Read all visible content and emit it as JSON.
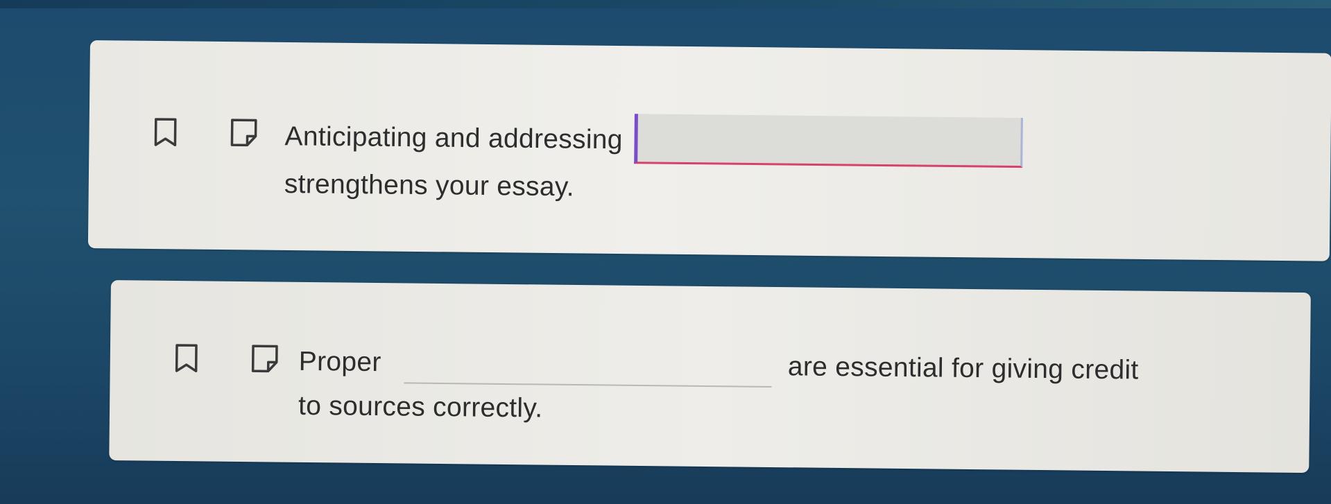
{
  "questions": [
    {
      "before": "Anticipating and addressing",
      "answer_value": "",
      "after": "",
      "continuation": "strengthens your essay."
    },
    {
      "before": "Proper",
      "answer_value": "",
      "after": "are essential for giving credit",
      "continuation": "to sources correctly."
    }
  ],
  "icons": {
    "bookmark": "bookmark-icon",
    "note": "note-icon"
  },
  "colors": {
    "background": "#1d4a6e",
    "card": "#efeeea",
    "text": "#2d2d2d",
    "active_input_fill": "#dcdcd9",
    "active_input_left_border": "#7c4bc7",
    "active_input_underline": "#d6426a"
  }
}
